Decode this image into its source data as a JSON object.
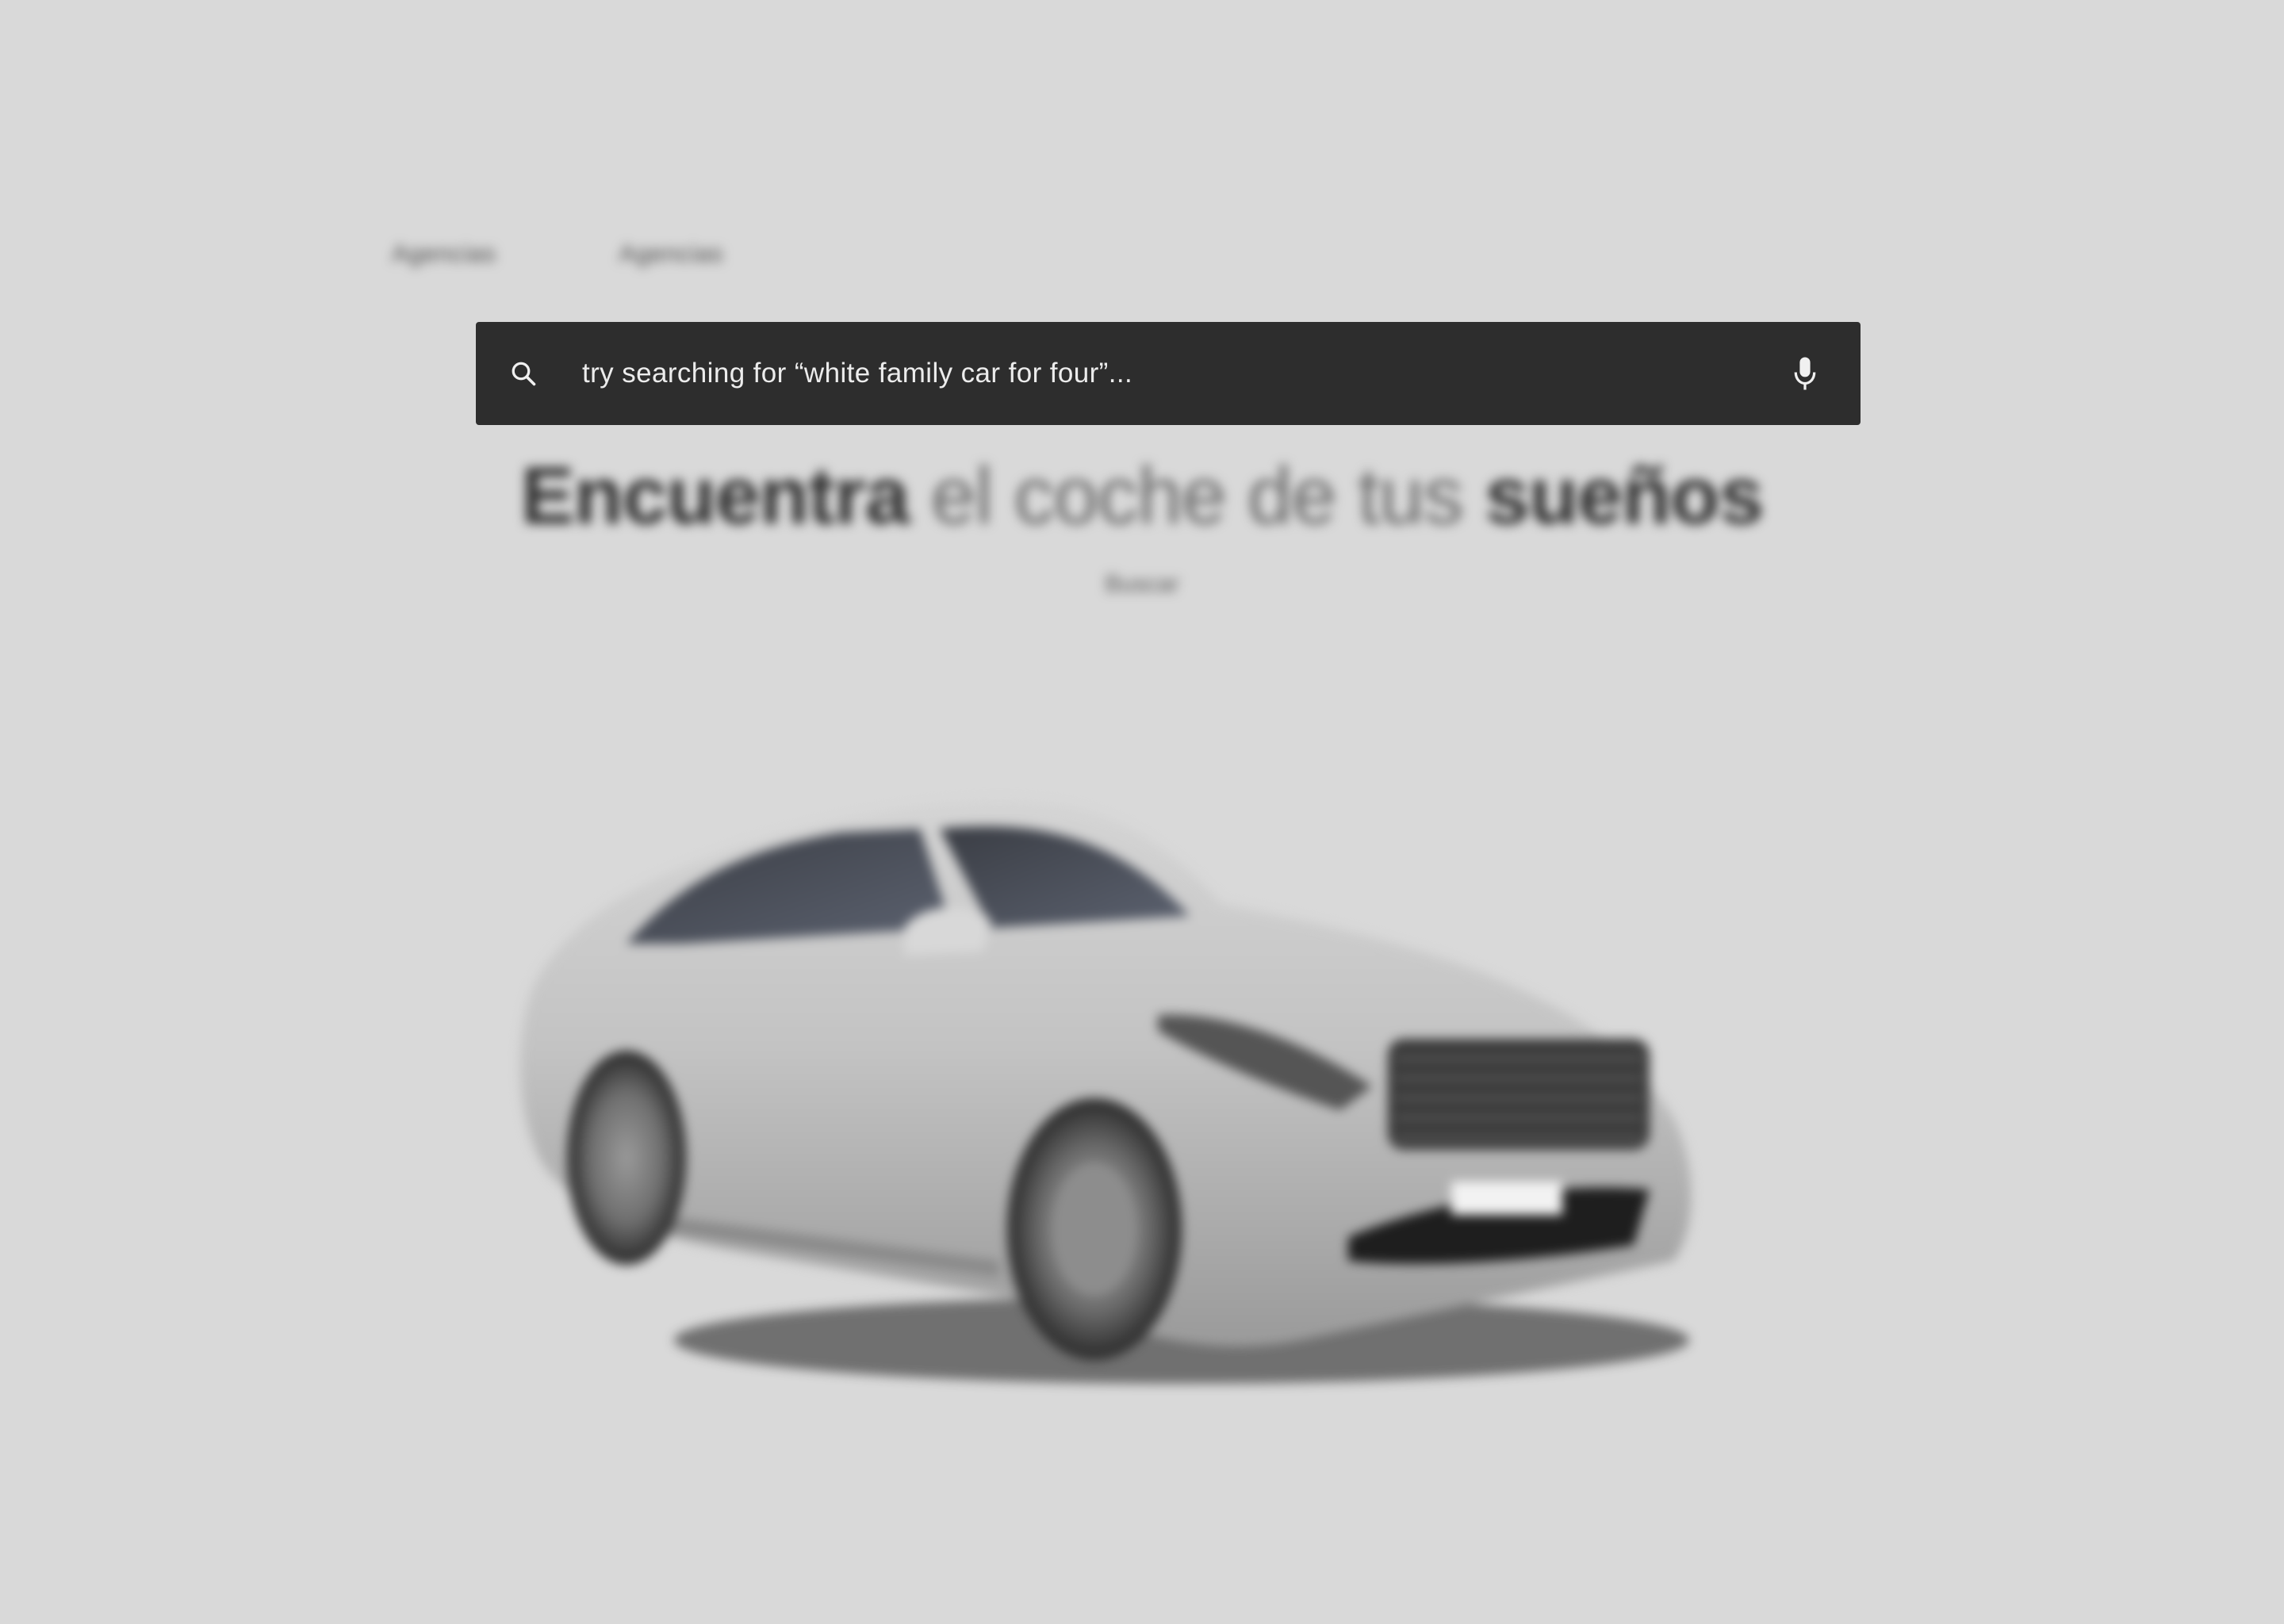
{
  "nav": {
    "links": [
      {
        "label": "Agencias"
      },
      {
        "label": "Agencias"
      }
    ]
  },
  "search": {
    "placeholder": "try searching for “white family car for four”...",
    "search_icon": "search-icon",
    "mic_icon": "microphone-icon"
  },
  "hero": {
    "headline_part1": "Encuentra",
    "headline_part2": " el coche de tus ",
    "headline_part3": "sueños",
    "sub_link": "Buscar"
  },
  "colors": {
    "background": "#d9d9d9",
    "search_bar": "#2d2d2d",
    "search_text": "#f0f0f0",
    "headline_strong": "#2e2e2e",
    "headline_light": "#6a6a6a"
  }
}
